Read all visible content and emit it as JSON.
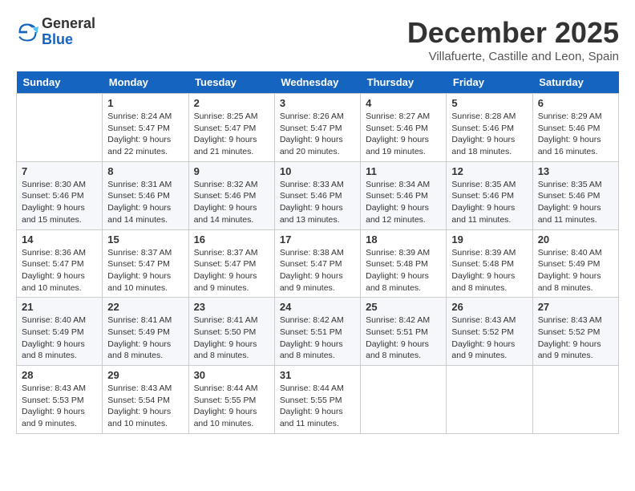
{
  "header": {
    "logo_general": "General",
    "logo_blue": "Blue",
    "month_title": "December 2025",
    "location": "Villafuerte, Castille and Leon, Spain"
  },
  "days_of_week": [
    "Sunday",
    "Monday",
    "Tuesday",
    "Wednesday",
    "Thursday",
    "Friday",
    "Saturday"
  ],
  "weeks": [
    [
      {
        "day": "",
        "info": ""
      },
      {
        "day": "1",
        "info": "Sunrise: 8:24 AM\nSunset: 5:47 PM\nDaylight: 9 hours\nand 22 minutes."
      },
      {
        "day": "2",
        "info": "Sunrise: 8:25 AM\nSunset: 5:47 PM\nDaylight: 9 hours\nand 21 minutes."
      },
      {
        "day": "3",
        "info": "Sunrise: 8:26 AM\nSunset: 5:47 PM\nDaylight: 9 hours\nand 20 minutes."
      },
      {
        "day": "4",
        "info": "Sunrise: 8:27 AM\nSunset: 5:46 PM\nDaylight: 9 hours\nand 19 minutes."
      },
      {
        "day": "5",
        "info": "Sunrise: 8:28 AM\nSunset: 5:46 PM\nDaylight: 9 hours\nand 18 minutes."
      },
      {
        "day": "6",
        "info": "Sunrise: 8:29 AM\nSunset: 5:46 PM\nDaylight: 9 hours\nand 16 minutes."
      }
    ],
    [
      {
        "day": "7",
        "info": "Sunrise: 8:30 AM\nSunset: 5:46 PM\nDaylight: 9 hours\nand 15 minutes."
      },
      {
        "day": "8",
        "info": "Sunrise: 8:31 AM\nSunset: 5:46 PM\nDaylight: 9 hours\nand 14 minutes."
      },
      {
        "day": "9",
        "info": "Sunrise: 8:32 AM\nSunset: 5:46 PM\nDaylight: 9 hours\nand 14 minutes."
      },
      {
        "day": "10",
        "info": "Sunrise: 8:33 AM\nSunset: 5:46 PM\nDaylight: 9 hours\nand 13 minutes."
      },
      {
        "day": "11",
        "info": "Sunrise: 8:34 AM\nSunset: 5:46 PM\nDaylight: 9 hours\nand 12 minutes."
      },
      {
        "day": "12",
        "info": "Sunrise: 8:35 AM\nSunset: 5:46 PM\nDaylight: 9 hours\nand 11 minutes."
      },
      {
        "day": "13",
        "info": "Sunrise: 8:35 AM\nSunset: 5:46 PM\nDaylight: 9 hours\nand 11 minutes."
      }
    ],
    [
      {
        "day": "14",
        "info": "Sunrise: 8:36 AM\nSunset: 5:47 PM\nDaylight: 9 hours\nand 10 minutes."
      },
      {
        "day": "15",
        "info": "Sunrise: 8:37 AM\nSunset: 5:47 PM\nDaylight: 9 hours\nand 10 minutes."
      },
      {
        "day": "16",
        "info": "Sunrise: 8:37 AM\nSunset: 5:47 PM\nDaylight: 9 hours\nand 9 minutes."
      },
      {
        "day": "17",
        "info": "Sunrise: 8:38 AM\nSunset: 5:47 PM\nDaylight: 9 hours\nand 9 minutes."
      },
      {
        "day": "18",
        "info": "Sunrise: 8:39 AM\nSunset: 5:48 PM\nDaylight: 9 hours\nand 8 minutes."
      },
      {
        "day": "19",
        "info": "Sunrise: 8:39 AM\nSunset: 5:48 PM\nDaylight: 9 hours\nand 8 minutes."
      },
      {
        "day": "20",
        "info": "Sunrise: 8:40 AM\nSunset: 5:49 PM\nDaylight: 9 hours\nand 8 minutes."
      }
    ],
    [
      {
        "day": "21",
        "info": "Sunrise: 8:40 AM\nSunset: 5:49 PM\nDaylight: 9 hours\nand 8 minutes."
      },
      {
        "day": "22",
        "info": "Sunrise: 8:41 AM\nSunset: 5:49 PM\nDaylight: 9 hours\nand 8 minutes."
      },
      {
        "day": "23",
        "info": "Sunrise: 8:41 AM\nSunset: 5:50 PM\nDaylight: 9 hours\nand 8 minutes."
      },
      {
        "day": "24",
        "info": "Sunrise: 8:42 AM\nSunset: 5:51 PM\nDaylight: 9 hours\nand 8 minutes."
      },
      {
        "day": "25",
        "info": "Sunrise: 8:42 AM\nSunset: 5:51 PM\nDaylight: 9 hours\nand 8 minutes."
      },
      {
        "day": "26",
        "info": "Sunrise: 8:43 AM\nSunset: 5:52 PM\nDaylight: 9 hours\nand 9 minutes."
      },
      {
        "day": "27",
        "info": "Sunrise: 8:43 AM\nSunset: 5:52 PM\nDaylight: 9 hours\nand 9 minutes."
      }
    ],
    [
      {
        "day": "28",
        "info": "Sunrise: 8:43 AM\nSunset: 5:53 PM\nDaylight: 9 hours\nand 9 minutes."
      },
      {
        "day": "29",
        "info": "Sunrise: 8:43 AM\nSunset: 5:54 PM\nDaylight: 9 hours\nand 10 minutes."
      },
      {
        "day": "30",
        "info": "Sunrise: 8:44 AM\nSunset: 5:55 PM\nDaylight: 9 hours\nand 10 minutes."
      },
      {
        "day": "31",
        "info": "Sunrise: 8:44 AM\nSunset: 5:55 PM\nDaylight: 9 hours\nand 11 minutes."
      },
      {
        "day": "",
        "info": ""
      },
      {
        "day": "",
        "info": ""
      },
      {
        "day": "",
        "info": ""
      }
    ]
  ]
}
